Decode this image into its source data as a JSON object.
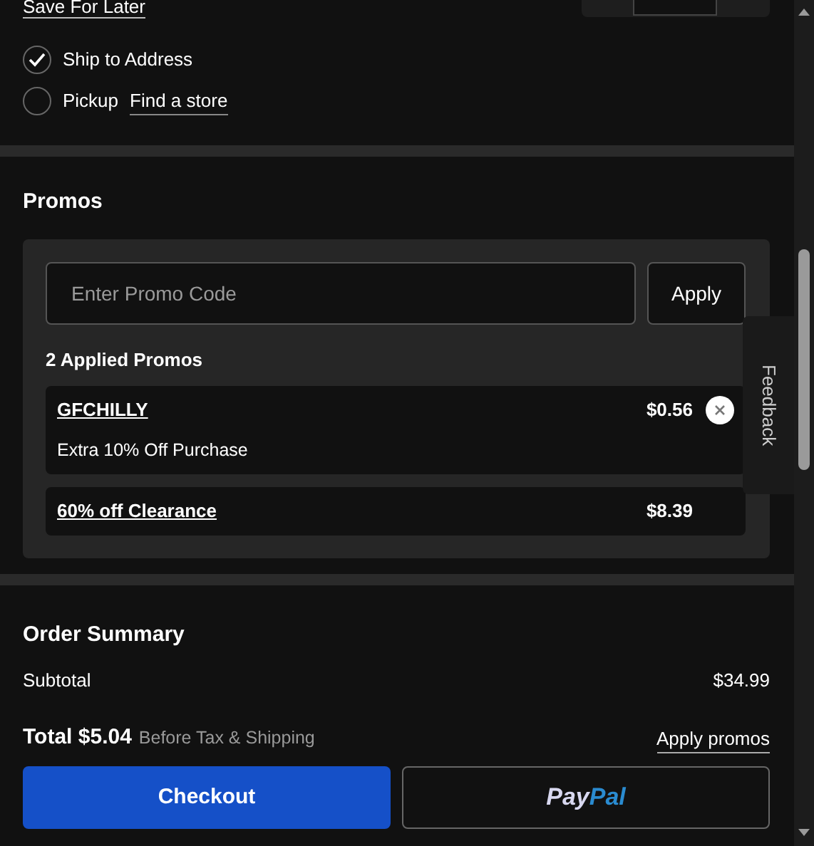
{
  "save_for_later": "Save For Later",
  "fulfillment": [
    {
      "label": "Ship to Address",
      "selected": true
    },
    {
      "label": "Pickup",
      "selected": false,
      "link": "Find a store"
    }
  ],
  "promos": {
    "title": "Promos",
    "placeholder": "Enter Promo Code",
    "apply": "Apply",
    "applied_heading": "2 Applied Promos",
    "applied": [
      {
        "code": "GFCHILLY",
        "amount": "$0.56",
        "description": "Extra 10% Off Purchase",
        "removable": true
      },
      {
        "code": "60% off Clearance",
        "amount": "$8.39",
        "removable": false
      }
    ]
  },
  "feedback": "Feedback",
  "order_summary": {
    "title": "Order Summary",
    "rows": [
      {
        "label": "Subtotal",
        "value": "$34.99"
      }
    ]
  },
  "footer": {
    "total": "Total $5.04",
    "note": "Before Tax & Shipping",
    "apply_promos": "Apply promos",
    "checkout": "Checkout",
    "paypal": [
      "Pay",
      "Pal"
    ]
  }
}
